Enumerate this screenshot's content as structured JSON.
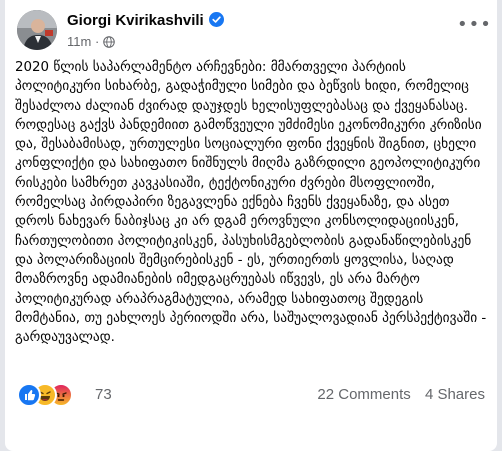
{
  "post": {
    "author": "Giorgi Kvirikashvili",
    "time": "11m",
    "verified": true,
    "audience_icon": "globe-icon",
    "body": "2020 წლის საპარლამენტო არჩევნები: მმართველი პარტიის პოლიტიკური სიხარბე, გადაჭიმული სიმები და ბეწვის ხიდი, რომელიც შესაძლოა ძალიან ძვირად დაუჯდეს ხელისუფლებასაც და ქვეყანასაც.\nროდესაც გაქვს პანდემიით გამოწვეული უმძიმესი ეკონომიკური კრიზისი და, შესაბამისად, ურთულესი სოციალური ფონი ქვეყნის შიგნით, ცხელი კონფლიქტი და სახიფათო ნიშნულს მიღმა გაზრდილი გეოპოლიტიკური რისკები სამხრეთ კავკასიაში, ტექტონიკური ძვრები მსოფლიოში, რომელსაც პირდაპირი ზეგავლენა ექნება ჩვენს ქვეყანაზე, და ასეთ დროს ნახევარ ნაბიჯსაც კი არ დგამ ეროვნული კონსოლიდაციისკენ, ჩართულობითი პოლიტიკისკენ, პასუხისმგებლობის გადანაწილებისკენ და პოლარიზაციის შემცირებისკენ - ეს, ურთიერთს ყოვლისა, საღად მოაზროვნე ადამიანების იმედგაცრუებას იწვევს, ეს არა მარტო პოლიტიკურად არაპრაგმატულია, არამედ სახიფათოც შედეგის მომტანია, თუ ეახლოეს პერიოდში არა, საშუალოვადიან პერსპექტივაში - გარდაუვალად."
  },
  "footer": {
    "reaction_count": "73",
    "comments": "22 Comments",
    "shares": "4 Shares"
  },
  "colors": {
    "like": "#1877f2",
    "haha": "#f7b928",
    "angry": "#e9710f"
  }
}
